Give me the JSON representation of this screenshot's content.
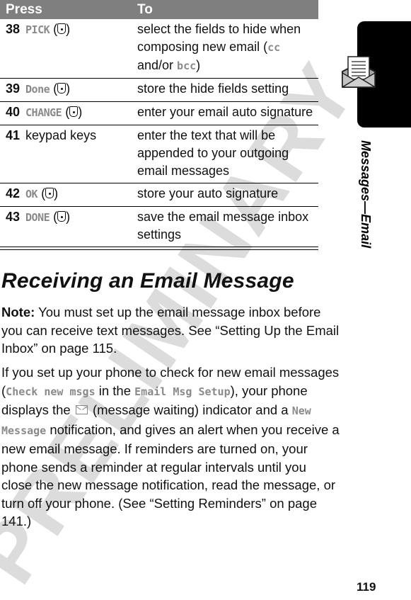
{
  "watermark": "PRELIMINARY",
  "table": {
    "headers": {
      "press": "Press",
      "to": "To"
    },
    "rows": [
      {
        "step": "38",
        "press_softkey": "PICK",
        "press_text": "",
        "key_icon": "center-select-key",
        "to_segments": [
          "select the fields to hide when composing new email (",
          "cc",
          " and/or ",
          "bcc",
          ")"
        ]
      },
      {
        "step": "39",
        "press_softkey": "Done",
        "press_text": "",
        "key_icon": "center-select-key",
        "to": "store the hide fields setting"
      },
      {
        "step": "40",
        "press_softkey": "CHANGE",
        "press_text": "",
        "key_icon": "center-select-key",
        "to": "enter your email auto signature"
      },
      {
        "step": "41",
        "press_softkey": "",
        "press_text": "keypad keys",
        "key_icon": "",
        "to": "enter the text that will be appended to your outgoing email messages"
      },
      {
        "step": "42",
        "press_softkey": "OK",
        "press_text": "",
        "key_icon": "center-select-key",
        "to": "store your auto signature"
      },
      {
        "step": "43",
        "press_softkey": "DONE",
        "press_text": "",
        "key_icon": "center-select-key",
        "to": "save the email message inbox settings"
      }
    ]
  },
  "side_tab": {
    "label": "Messages—Email",
    "icon": "envelope-with-letter-icon"
  },
  "section": {
    "heading": "Receiving an Email Message",
    "note_label": "Note:",
    "note_text": " You must set up the email message inbox before you can receive text messages. See “Setting Up the Email Inbox” on page 115.",
    "para2": {
      "t1": "If you set up your phone to check for new email messages (",
      "k1": "Check new msgs",
      "t2": " in the ",
      "k2": "Email Msg Setup",
      "t3": "), your phone displays the ",
      "icon": "message-waiting-icon",
      "t4": " (message waiting) indicator and a ",
      "k3": "New Message",
      "t5": " notification, and gives an alert when you receive a new email message. If reminders are turned on, your phone sends a reminder at regular intervals until you close the new message notification, read the message, or turn off your phone. (See “Setting Reminders” on page 141.)"
    }
  },
  "page_number": "119"
}
